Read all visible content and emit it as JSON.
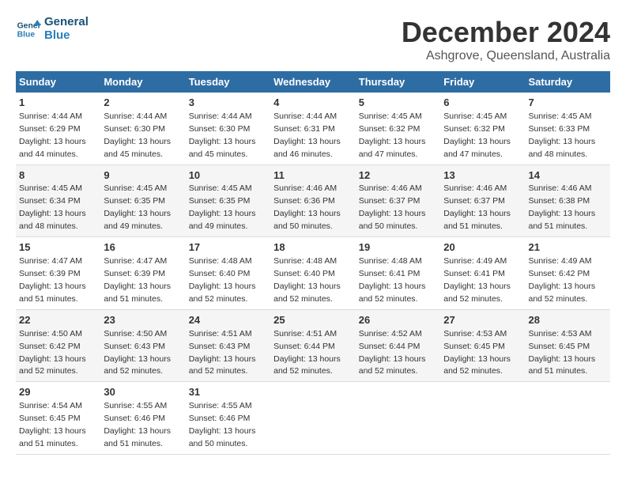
{
  "logo": {
    "line1": "General",
    "line2": "Blue"
  },
  "title": "December 2024",
  "subtitle": "Ashgrove, Queensland, Australia",
  "days_of_week": [
    "Sunday",
    "Monday",
    "Tuesday",
    "Wednesday",
    "Thursday",
    "Friday",
    "Saturday"
  ],
  "weeks": [
    [
      {
        "num": "1",
        "sunrise": "4:44 AM",
        "sunset": "6:29 PM",
        "daylight": "13 hours and 44 minutes."
      },
      {
        "num": "2",
        "sunrise": "4:44 AM",
        "sunset": "6:30 PM",
        "daylight": "13 hours and 45 minutes."
      },
      {
        "num": "3",
        "sunrise": "4:44 AM",
        "sunset": "6:30 PM",
        "daylight": "13 hours and 45 minutes."
      },
      {
        "num": "4",
        "sunrise": "4:44 AM",
        "sunset": "6:31 PM",
        "daylight": "13 hours and 46 minutes."
      },
      {
        "num": "5",
        "sunrise": "4:45 AM",
        "sunset": "6:32 PM",
        "daylight": "13 hours and 47 minutes."
      },
      {
        "num": "6",
        "sunrise": "4:45 AM",
        "sunset": "6:32 PM",
        "daylight": "13 hours and 47 minutes."
      },
      {
        "num": "7",
        "sunrise": "4:45 AM",
        "sunset": "6:33 PM",
        "daylight": "13 hours and 48 minutes."
      }
    ],
    [
      {
        "num": "8",
        "sunrise": "4:45 AM",
        "sunset": "6:34 PM",
        "daylight": "13 hours and 48 minutes."
      },
      {
        "num": "9",
        "sunrise": "4:45 AM",
        "sunset": "6:35 PM",
        "daylight": "13 hours and 49 minutes."
      },
      {
        "num": "10",
        "sunrise": "4:45 AM",
        "sunset": "6:35 PM",
        "daylight": "13 hours and 49 minutes."
      },
      {
        "num": "11",
        "sunrise": "4:46 AM",
        "sunset": "6:36 PM",
        "daylight": "13 hours and 50 minutes."
      },
      {
        "num": "12",
        "sunrise": "4:46 AM",
        "sunset": "6:37 PM",
        "daylight": "13 hours and 50 minutes."
      },
      {
        "num": "13",
        "sunrise": "4:46 AM",
        "sunset": "6:37 PM",
        "daylight": "13 hours and 51 minutes."
      },
      {
        "num": "14",
        "sunrise": "4:46 AM",
        "sunset": "6:38 PM",
        "daylight": "13 hours and 51 minutes."
      }
    ],
    [
      {
        "num": "15",
        "sunrise": "4:47 AM",
        "sunset": "6:39 PM",
        "daylight": "13 hours and 51 minutes."
      },
      {
        "num": "16",
        "sunrise": "4:47 AM",
        "sunset": "6:39 PM",
        "daylight": "13 hours and 51 minutes."
      },
      {
        "num": "17",
        "sunrise": "4:48 AM",
        "sunset": "6:40 PM",
        "daylight": "13 hours and 52 minutes."
      },
      {
        "num": "18",
        "sunrise": "4:48 AM",
        "sunset": "6:40 PM",
        "daylight": "13 hours and 52 minutes."
      },
      {
        "num": "19",
        "sunrise": "4:48 AM",
        "sunset": "6:41 PM",
        "daylight": "13 hours and 52 minutes."
      },
      {
        "num": "20",
        "sunrise": "4:49 AM",
        "sunset": "6:41 PM",
        "daylight": "13 hours and 52 minutes."
      },
      {
        "num": "21",
        "sunrise": "4:49 AM",
        "sunset": "6:42 PM",
        "daylight": "13 hours and 52 minutes."
      }
    ],
    [
      {
        "num": "22",
        "sunrise": "4:50 AM",
        "sunset": "6:42 PM",
        "daylight": "13 hours and 52 minutes."
      },
      {
        "num": "23",
        "sunrise": "4:50 AM",
        "sunset": "6:43 PM",
        "daylight": "13 hours and 52 minutes."
      },
      {
        "num": "24",
        "sunrise": "4:51 AM",
        "sunset": "6:43 PM",
        "daylight": "13 hours and 52 minutes."
      },
      {
        "num": "25",
        "sunrise": "4:51 AM",
        "sunset": "6:44 PM",
        "daylight": "13 hours and 52 minutes."
      },
      {
        "num": "26",
        "sunrise": "4:52 AM",
        "sunset": "6:44 PM",
        "daylight": "13 hours and 52 minutes."
      },
      {
        "num": "27",
        "sunrise": "4:53 AM",
        "sunset": "6:45 PM",
        "daylight": "13 hours and 52 minutes."
      },
      {
        "num": "28",
        "sunrise": "4:53 AM",
        "sunset": "6:45 PM",
        "daylight": "13 hours and 51 minutes."
      }
    ],
    [
      {
        "num": "29",
        "sunrise": "4:54 AM",
        "sunset": "6:45 PM",
        "daylight": "13 hours and 51 minutes."
      },
      {
        "num": "30",
        "sunrise": "4:55 AM",
        "sunset": "6:46 PM",
        "daylight": "13 hours and 51 minutes."
      },
      {
        "num": "31",
        "sunrise": "4:55 AM",
        "sunset": "6:46 PM",
        "daylight": "13 hours and 50 minutes."
      },
      null,
      null,
      null,
      null
    ]
  ],
  "labels": {
    "sunrise": "Sunrise:",
    "sunset": "Sunset:",
    "daylight": "Daylight:"
  }
}
